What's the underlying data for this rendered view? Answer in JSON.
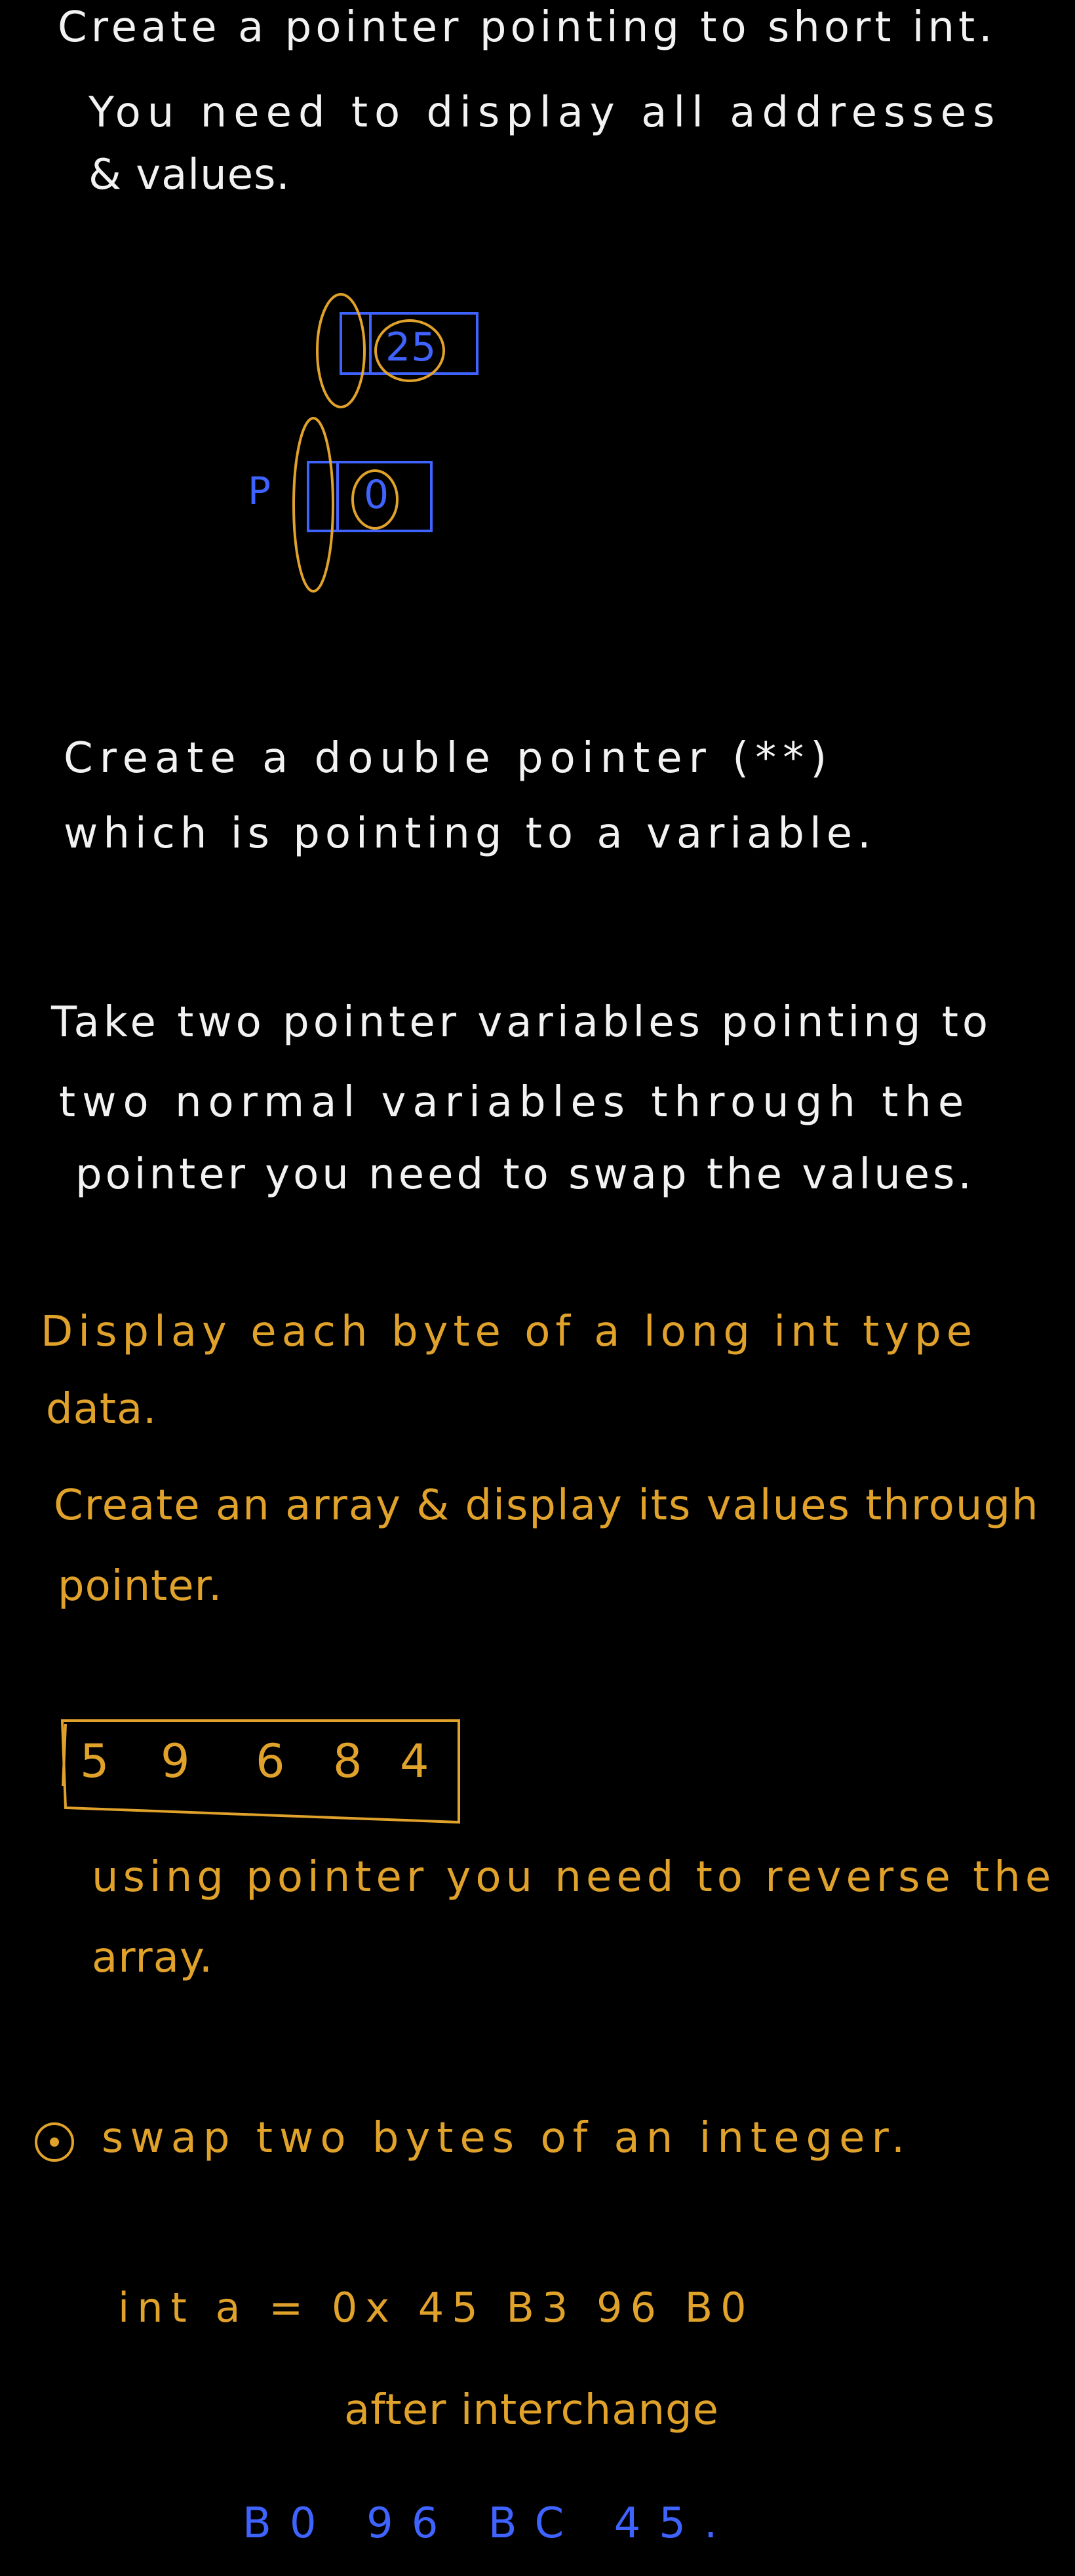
{
  "colors": {
    "background": "#000000",
    "white_ink": "#f2f2f2",
    "yellow_ink": "#e0a22a",
    "blue_ink": "#3f63ff"
  },
  "task1": {
    "line1": "Create a pointer pointing to short int.",
    "line2": "You need to display all addresses",
    "line3": "& values."
  },
  "diagram1": {
    "var_value": "25",
    "pointer_label": "P",
    "pointer_value": "0"
  },
  "task2": {
    "line1": "Create a double pointer (**)",
    "line2": "which is pointing to a variable."
  },
  "task3": {
    "line1": "Take two pointer variables pointing to",
    "line2": "two normal variables through the",
    "line3": "pointer you need to swap the values."
  },
  "task4": {
    "line1": "Display each byte of a long int type",
    "line2": "data."
  },
  "task5": {
    "line1": "Create an array & display its values through",
    "line2": "pointer."
  },
  "array": {
    "values": [
      "5",
      "9",
      "6",
      "8",
      "4"
    ]
  },
  "task6": {
    "line1": "using pointer you need to reverse the",
    "line2": "array."
  },
  "task7": {
    "line1": "swap two bytes of an integer.",
    "code": "int a = 0x 45 B3 96 B0",
    "after": "after interchange",
    "result": "B0 96 BC 45."
  }
}
